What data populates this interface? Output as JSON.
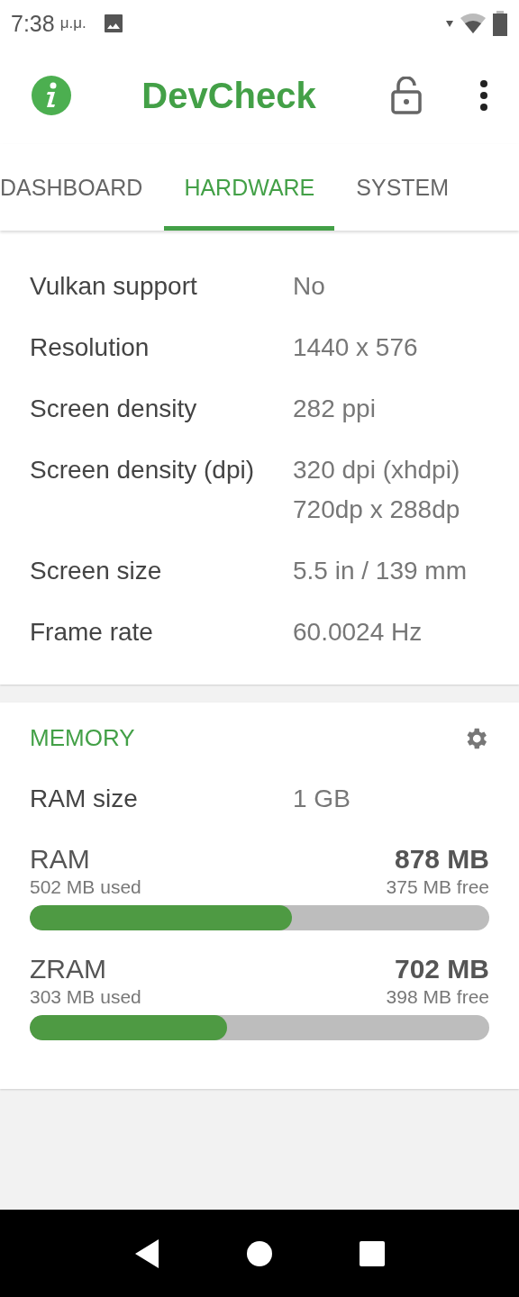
{
  "status_bar": {
    "time": "7:38",
    "ampm": "μ.μ."
  },
  "app_bar": {
    "title": "DevCheck"
  },
  "tabs": [
    {
      "label": "DASHBOARD",
      "selected": false
    },
    {
      "label": "HARDWARE",
      "selected": true
    },
    {
      "label": "SYSTEM",
      "selected": false
    }
  ],
  "display": {
    "rows": [
      {
        "label": "Vulkan support",
        "value": "No"
      },
      {
        "label": "Resolution",
        "value": "1440 x 576"
      },
      {
        "label": "Screen density",
        "value": "282 ppi"
      },
      {
        "label": "Screen density (dpi)",
        "value": "320 dpi (xhdpi) 720dp x 288dp"
      },
      {
        "label": "Screen size",
        "value": "5.5 in / 139 mm"
      },
      {
        "label": "Frame rate",
        "value": "60.0024 Hz"
      }
    ]
  },
  "memory": {
    "title": "MEMORY",
    "rows": [
      {
        "label": "RAM size",
        "value": "1 GB"
      }
    ],
    "meters": [
      {
        "name": "RAM",
        "total": "878 MB",
        "used": "502 MB used",
        "free": "375 MB free",
        "level": 0.57
      },
      {
        "name": "ZRAM",
        "total": "702 MB",
        "used": "303 MB used",
        "free": "398 MB free",
        "level": 0.43
      }
    ]
  }
}
